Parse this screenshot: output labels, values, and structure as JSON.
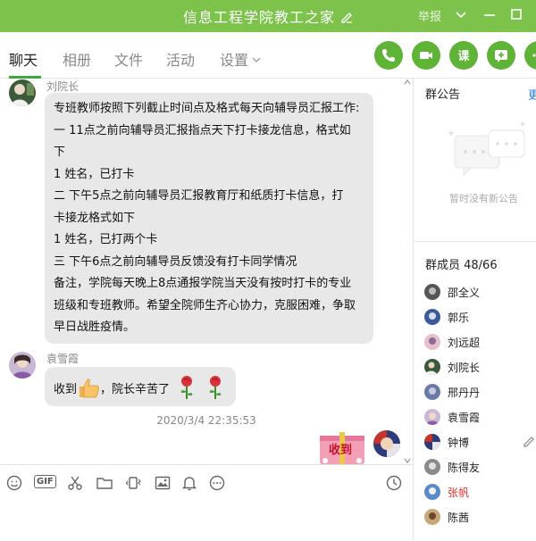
{
  "window": {
    "title": "信息工程学院教工之家",
    "report_label": "举报"
  },
  "tabs": [
    {
      "label": "聊天"
    },
    {
      "label": "相册"
    },
    {
      "label": "文件"
    },
    {
      "label": "活动"
    },
    {
      "label": "设置"
    }
  ],
  "toolbar": {
    "class_label": "课"
  },
  "messages": [
    {
      "sender": "刘院长",
      "lines": [
        "专班教师按照下列截止时间点及格式每天向辅导员汇报工作:",
        "一    11点之前向辅导员汇报指点天下打卡接龙信息，格式如",
        "下",
        "1  姓名，已打卡",
        "二    下午5点之前向辅导员汇报教育厅和纸质打卡信息，打",
        "卡接龙格式如下",
        "1  姓名，已打两个卡",
        "三    下午6点之前向辅导员反馈没有打卡同学情况",
        "备注，学院每天晚上8点通报学院当天没有按时打卡的专业",
        "班级和专班教师。希望全院师生齐心协力，克服困难，争取",
        "早日战胜疫情。"
      ]
    },
    {
      "sender": "袁雪霞",
      "text_before": "收到",
      "text_after": "，院长辛苦了"
    }
  ],
  "timestamp": "2020/3/4 22:35:53",
  "sticker_text": "收到",
  "panel": {
    "notice_title": "群公告",
    "notice_more": "更",
    "notice_empty": "暂时没有新公告",
    "members_title": "群成员 48/66",
    "members": [
      {
        "name": "邵全义",
        "highlight": false
      },
      {
        "name": "郭乐",
        "highlight": false
      },
      {
        "name": "刘远超",
        "highlight": false
      },
      {
        "name": "刘院长",
        "highlight": false
      },
      {
        "name": "邢丹丹",
        "highlight": false
      },
      {
        "name": "袁雪霞",
        "highlight": false
      },
      {
        "name": "钟博",
        "highlight": false
      },
      {
        "name": "陈得友",
        "highlight": false
      },
      {
        "name": "张帆",
        "highlight": true
      },
      {
        "name": "陈茜",
        "highlight": false
      }
    ]
  },
  "colors": {
    "accent": "#7cc24b",
    "button_green": "#5fb336",
    "bubble": "#e8e8e8",
    "member_highlight": "#e0322b"
  }
}
